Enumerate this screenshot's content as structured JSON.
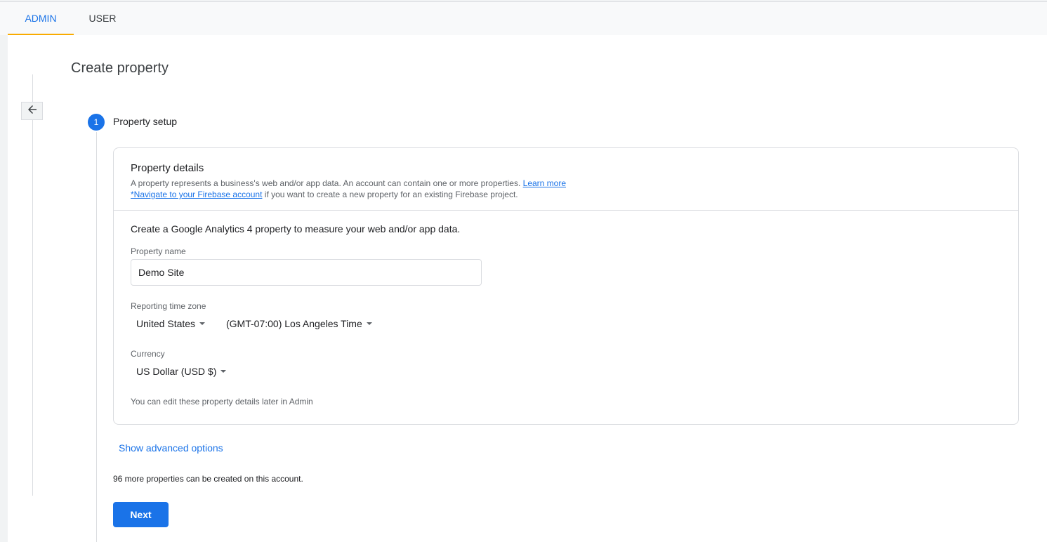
{
  "tabs": [
    {
      "label": "ADMIN"
    },
    {
      "label": "USER"
    }
  ],
  "page": {
    "title": "Create property"
  },
  "step": {
    "number": "1",
    "label": "Property setup"
  },
  "card": {
    "title": "Property details",
    "description": "A property represents a business's web and/or app data. An account can contain one or more properties.",
    "learn_more": "Learn more",
    "firebase_link": "*Navigate to your Firebase account",
    "firebase_text": " if you want to create a new property for an existing Firebase project.",
    "intro": "Create a Google Analytics 4 property to measure your web and/or app data.",
    "property_name_label": "Property name",
    "property_name_value": "Demo Site",
    "timezone_label": "Reporting time zone",
    "country": "United States",
    "timezone": "(GMT-07:00) Los Angeles Time",
    "currency_label": "Currency",
    "currency": "US Dollar (USD $)",
    "note": "You can edit these property details later in Admin"
  },
  "footer": {
    "advanced": "Show advanced options",
    "remaining": "96 more properties can be created on this account.",
    "next": "Next"
  },
  "colors": {
    "accent": "#1a73e8",
    "tab_indicator": "#f9ab00"
  },
  "icons": {
    "back": "arrow-left-icon",
    "dropdown": "caret-down-icon"
  }
}
